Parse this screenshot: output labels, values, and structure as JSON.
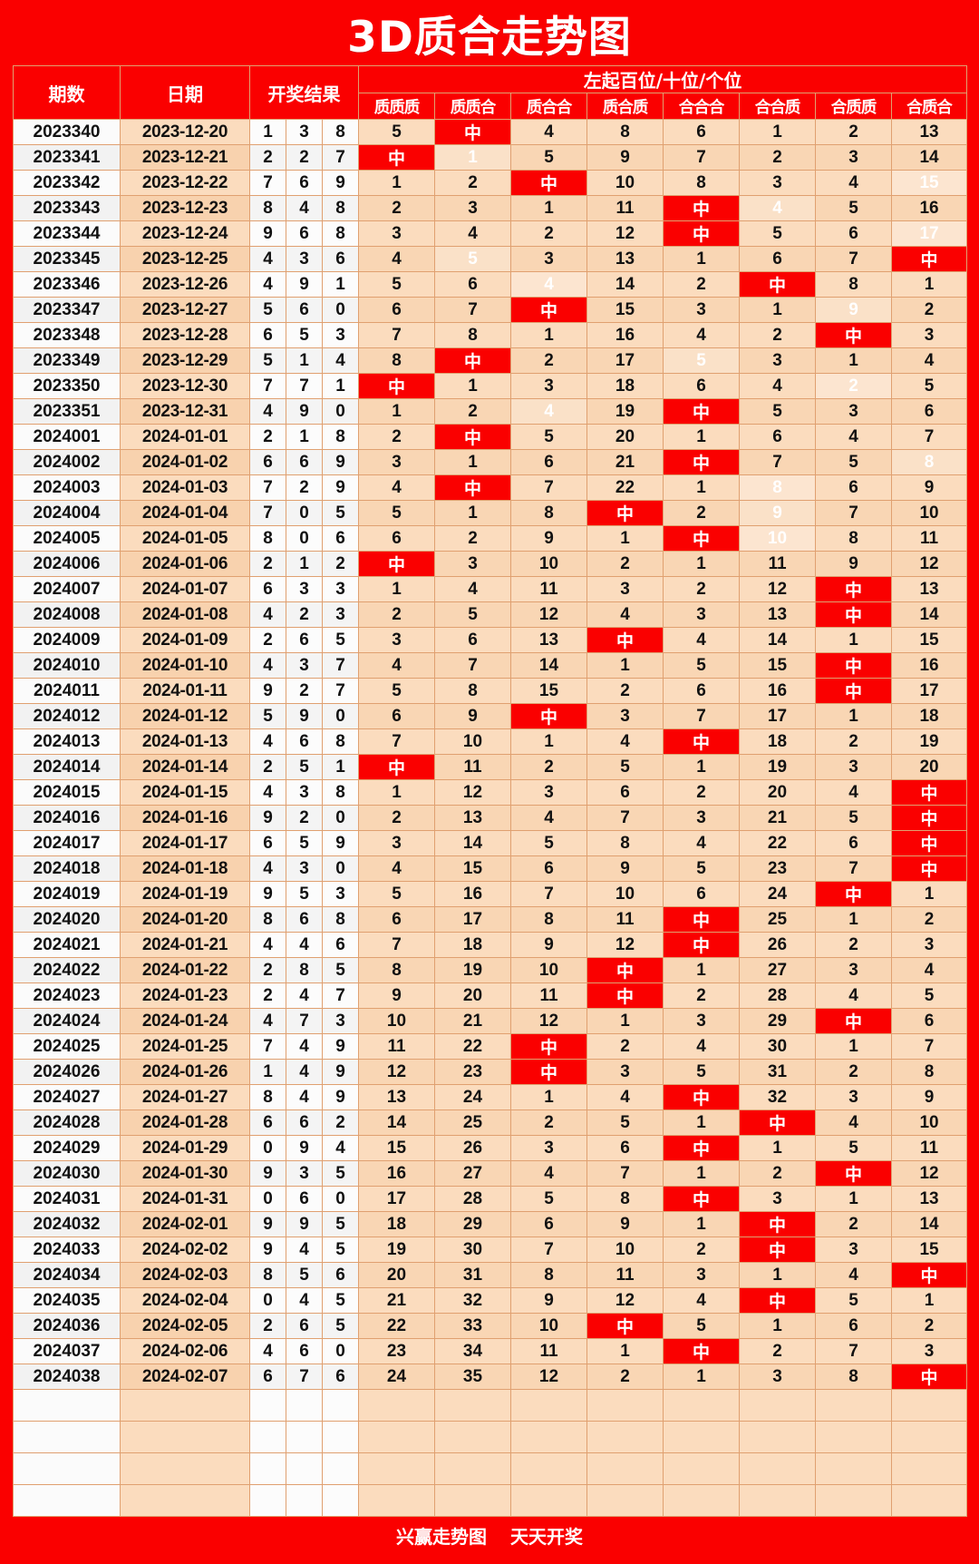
{
  "title": "3D质合走势图",
  "header": {
    "issue": "期数",
    "date": "日期",
    "result": "开奖结果",
    "group": "左起百位/十位/个位",
    "columns": [
      "质质质",
      "质质合",
      "质合合",
      "质合质",
      "合合合",
      "合合质",
      "合质质",
      "合质合"
    ]
  },
  "footer": {
    "left": "兴赢走势图",
    "right": "天天开奖"
  },
  "colors": {
    "brand_red": "#fa0000",
    "hit_red": "#fa0000",
    "cell_peach": "#fbdcbe",
    "cell_white": "#fcfcfc",
    "grid_line": "#e0a070",
    "hit_text": "#ffffff",
    "faded_text": "#ffffff"
  },
  "hit_label": "中",
  "blank_rows": 4,
  "rows": [
    {
      "issue": "2023340",
      "date": "2023-12-20",
      "balls": [
        "1",
        "3",
        "8"
      ],
      "cells": [
        "5",
        "中",
        "4",
        "8",
        "6",
        "1",
        "2",
        "13"
      ],
      "faded": []
    },
    {
      "issue": "2023341",
      "date": "2023-12-21",
      "balls": [
        "2",
        "2",
        "7"
      ],
      "cells": [
        "中",
        "1",
        "5",
        "9",
        "7",
        "2",
        "3",
        "14"
      ],
      "faded": [
        1
      ]
    },
    {
      "issue": "2023342",
      "date": "2023-12-22",
      "balls": [
        "7",
        "6",
        "9"
      ],
      "cells": [
        "1",
        "2",
        "中",
        "10",
        "8",
        "3",
        "4",
        "15"
      ],
      "faded": [
        7
      ]
    },
    {
      "issue": "2023343",
      "date": "2023-12-23",
      "balls": [
        "8",
        "4",
        "8"
      ],
      "cells": [
        "2",
        "3",
        "1",
        "11",
        "中",
        "4",
        "5",
        "16"
      ],
      "faded": [
        5
      ]
    },
    {
      "issue": "2023344",
      "date": "2023-12-24",
      "balls": [
        "9",
        "6",
        "8"
      ],
      "cells": [
        "3",
        "4",
        "2",
        "12",
        "中",
        "5",
        "6",
        "17"
      ],
      "faded": [
        7
      ]
    },
    {
      "issue": "2023345",
      "date": "2023-12-25",
      "balls": [
        "4",
        "3",
        "6"
      ],
      "cells": [
        "4",
        "5",
        "3",
        "13",
        "1",
        "6",
        "7",
        "中"
      ],
      "faded": [
        1
      ]
    },
    {
      "issue": "2023346",
      "date": "2023-12-26",
      "balls": [
        "4",
        "9",
        "1"
      ],
      "cells": [
        "5",
        "6",
        "4",
        "14",
        "2",
        "中",
        "8",
        "1"
      ],
      "faded": [
        2
      ]
    },
    {
      "issue": "2023347",
      "date": "2023-12-27",
      "balls": [
        "5",
        "6",
        "0"
      ],
      "cells": [
        "6",
        "7",
        "中",
        "15",
        "3",
        "1",
        "9",
        "2"
      ],
      "faded": [
        6
      ]
    },
    {
      "issue": "2023348",
      "date": "2023-12-28",
      "balls": [
        "6",
        "5",
        "3"
      ],
      "cells": [
        "7",
        "8",
        "1",
        "16",
        "4",
        "2",
        "中",
        "3"
      ],
      "faded": []
    },
    {
      "issue": "2023349",
      "date": "2023-12-29",
      "balls": [
        "5",
        "1",
        "4"
      ],
      "cells": [
        "8",
        "中",
        "2",
        "17",
        "5",
        "3",
        "1",
        "4"
      ],
      "faded": [
        4
      ]
    },
    {
      "issue": "2023350",
      "date": "2023-12-30",
      "balls": [
        "7",
        "7",
        "1"
      ],
      "cells": [
        "中",
        "1",
        "3",
        "18",
        "6",
        "4",
        "2",
        "5"
      ],
      "faded": [
        6
      ]
    },
    {
      "issue": "2023351",
      "date": "2023-12-31",
      "balls": [
        "4",
        "9",
        "0"
      ],
      "cells": [
        "1",
        "2",
        "4",
        "19",
        "中",
        "5",
        "3",
        "6"
      ],
      "faded": [
        2
      ]
    },
    {
      "issue": "2024001",
      "date": "2024-01-01",
      "balls": [
        "2",
        "1",
        "8"
      ],
      "cells": [
        "2",
        "中",
        "5",
        "20",
        "1",
        "6",
        "4",
        "7"
      ],
      "faded": []
    },
    {
      "issue": "2024002",
      "date": "2024-01-02",
      "balls": [
        "6",
        "6",
        "9"
      ],
      "cells": [
        "3",
        "1",
        "6",
        "21",
        "中",
        "7",
        "5",
        "8"
      ],
      "faded": [
        7
      ]
    },
    {
      "issue": "2024003",
      "date": "2024-01-03",
      "balls": [
        "7",
        "2",
        "9"
      ],
      "cells": [
        "4",
        "中",
        "7",
        "22",
        "1",
        "8",
        "6",
        "9"
      ],
      "faded": [
        5
      ]
    },
    {
      "issue": "2024004",
      "date": "2024-01-04",
      "balls": [
        "7",
        "0",
        "5"
      ],
      "cells": [
        "5",
        "1",
        "8",
        "中",
        "2",
        "9",
        "7",
        "10"
      ],
      "faded": [
        5
      ]
    },
    {
      "issue": "2024005",
      "date": "2024-01-05",
      "balls": [
        "8",
        "0",
        "6"
      ],
      "cells": [
        "6",
        "2",
        "9",
        "1",
        "中",
        "10",
        "8",
        "11"
      ],
      "faded": [
        5
      ]
    },
    {
      "issue": "2024006",
      "date": "2024-01-06",
      "balls": [
        "2",
        "1",
        "2"
      ],
      "cells": [
        "中",
        "3",
        "10",
        "2",
        "1",
        "11",
        "9",
        "12"
      ],
      "faded": []
    },
    {
      "issue": "2024007",
      "date": "2024-01-07",
      "balls": [
        "6",
        "3",
        "3"
      ],
      "cells": [
        "1",
        "4",
        "11",
        "3",
        "2",
        "12",
        "中",
        "13"
      ],
      "faded": []
    },
    {
      "issue": "2024008",
      "date": "2024-01-08",
      "balls": [
        "4",
        "2",
        "3"
      ],
      "cells": [
        "2",
        "5",
        "12",
        "4",
        "3",
        "13",
        "中",
        "14"
      ],
      "faded": []
    },
    {
      "issue": "2024009",
      "date": "2024-01-09",
      "balls": [
        "2",
        "6",
        "5"
      ],
      "cells": [
        "3",
        "6",
        "13",
        "中",
        "4",
        "14",
        "1",
        "15"
      ],
      "faded": []
    },
    {
      "issue": "2024010",
      "date": "2024-01-10",
      "balls": [
        "4",
        "3",
        "7"
      ],
      "cells": [
        "4",
        "7",
        "14",
        "1",
        "5",
        "15",
        "中",
        "16"
      ],
      "faded": []
    },
    {
      "issue": "2024011",
      "date": "2024-01-11",
      "balls": [
        "9",
        "2",
        "7"
      ],
      "cells": [
        "5",
        "8",
        "15",
        "2",
        "6",
        "16",
        "中",
        "17"
      ],
      "faded": []
    },
    {
      "issue": "2024012",
      "date": "2024-01-12",
      "balls": [
        "5",
        "9",
        "0"
      ],
      "cells": [
        "6",
        "9",
        "中",
        "3",
        "7",
        "17",
        "1",
        "18"
      ],
      "faded": []
    },
    {
      "issue": "2024013",
      "date": "2024-01-13",
      "balls": [
        "4",
        "6",
        "8"
      ],
      "cells": [
        "7",
        "10",
        "1",
        "4",
        "中",
        "18",
        "2",
        "19"
      ],
      "faded": []
    },
    {
      "issue": "2024014",
      "date": "2024-01-14",
      "balls": [
        "2",
        "5",
        "1"
      ],
      "cells": [
        "中",
        "11",
        "2",
        "5",
        "1",
        "19",
        "3",
        "20"
      ],
      "faded": []
    },
    {
      "issue": "2024015",
      "date": "2024-01-15",
      "balls": [
        "4",
        "3",
        "8"
      ],
      "cells": [
        "1",
        "12",
        "3",
        "6",
        "2",
        "20",
        "4",
        "中"
      ],
      "faded": []
    },
    {
      "issue": "2024016",
      "date": "2024-01-16",
      "balls": [
        "9",
        "2",
        "0"
      ],
      "cells": [
        "2",
        "13",
        "4",
        "7",
        "3",
        "21",
        "5",
        "中"
      ],
      "faded": []
    },
    {
      "issue": "2024017",
      "date": "2024-01-17",
      "balls": [
        "6",
        "5",
        "9"
      ],
      "cells": [
        "3",
        "14",
        "5",
        "8",
        "4",
        "22",
        "6",
        "中"
      ],
      "faded": []
    },
    {
      "issue": "2024018",
      "date": "2024-01-18",
      "balls": [
        "4",
        "3",
        "0"
      ],
      "cells": [
        "4",
        "15",
        "6",
        "9",
        "5",
        "23",
        "7",
        "中"
      ],
      "faded": []
    },
    {
      "issue": "2024019",
      "date": "2024-01-19",
      "balls": [
        "9",
        "5",
        "3"
      ],
      "cells": [
        "5",
        "16",
        "7",
        "10",
        "6",
        "24",
        "中",
        "1"
      ],
      "faded": []
    },
    {
      "issue": "2024020",
      "date": "2024-01-20",
      "balls": [
        "8",
        "6",
        "8"
      ],
      "cells": [
        "6",
        "17",
        "8",
        "11",
        "中",
        "25",
        "1",
        "2"
      ],
      "faded": []
    },
    {
      "issue": "2024021",
      "date": "2024-01-21",
      "balls": [
        "4",
        "4",
        "6"
      ],
      "cells": [
        "7",
        "18",
        "9",
        "12",
        "中",
        "26",
        "2",
        "3"
      ],
      "faded": []
    },
    {
      "issue": "2024022",
      "date": "2024-01-22",
      "balls": [
        "2",
        "8",
        "5"
      ],
      "cells": [
        "8",
        "19",
        "10",
        "中",
        "1",
        "27",
        "3",
        "4"
      ],
      "faded": []
    },
    {
      "issue": "2024023",
      "date": "2024-01-23",
      "balls": [
        "2",
        "4",
        "7"
      ],
      "cells": [
        "9",
        "20",
        "11",
        "中",
        "2",
        "28",
        "4",
        "5"
      ],
      "faded": []
    },
    {
      "issue": "2024024",
      "date": "2024-01-24",
      "balls": [
        "4",
        "7",
        "3"
      ],
      "cells": [
        "10",
        "21",
        "12",
        "1",
        "3",
        "29",
        "中",
        "6"
      ],
      "faded": []
    },
    {
      "issue": "2024025",
      "date": "2024-01-25",
      "balls": [
        "7",
        "4",
        "9"
      ],
      "cells": [
        "11",
        "22",
        "中",
        "2",
        "4",
        "30",
        "1",
        "7"
      ],
      "faded": []
    },
    {
      "issue": "2024026",
      "date": "2024-01-26",
      "balls": [
        "1",
        "4",
        "9"
      ],
      "cells": [
        "12",
        "23",
        "中",
        "3",
        "5",
        "31",
        "2",
        "8"
      ],
      "faded": []
    },
    {
      "issue": "2024027",
      "date": "2024-01-27",
      "balls": [
        "8",
        "4",
        "9"
      ],
      "cells": [
        "13",
        "24",
        "1",
        "4",
        "中",
        "32",
        "3",
        "9"
      ],
      "faded": []
    },
    {
      "issue": "2024028",
      "date": "2024-01-28",
      "balls": [
        "6",
        "6",
        "2"
      ],
      "cells": [
        "14",
        "25",
        "2",
        "5",
        "1",
        "中",
        "4",
        "10"
      ],
      "faded": []
    },
    {
      "issue": "2024029",
      "date": "2024-01-29",
      "balls": [
        "0",
        "9",
        "4"
      ],
      "cells": [
        "15",
        "26",
        "3",
        "6",
        "中",
        "1",
        "5",
        "11"
      ],
      "faded": []
    },
    {
      "issue": "2024030",
      "date": "2024-01-30",
      "balls": [
        "9",
        "3",
        "5"
      ],
      "cells": [
        "16",
        "27",
        "4",
        "7",
        "1",
        "2",
        "中",
        "12"
      ],
      "faded": []
    },
    {
      "issue": "2024031",
      "date": "2024-01-31",
      "balls": [
        "0",
        "6",
        "0"
      ],
      "cells": [
        "17",
        "28",
        "5",
        "8",
        "中",
        "3",
        "1",
        "13"
      ],
      "faded": []
    },
    {
      "issue": "2024032",
      "date": "2024-02-01",
      "balls": [
        "9",
        "9",
        "5"
      ],
      "cells": [
        "18",
        "29",
        "6",
        "9",
        "1",
        "中",
        "2",
        "14"
      ],
      "faded": []
    },
    {
      "issue": "2024033",
      "date": "2024-02-02",
      "balls": [
        "9",
        "4",
        "5"
      ],
      "cells": [
        "19",
        "30",
        "7",
        "10",
        "2",
        "中",
        "3",
        "15"
      ],
      "faded": []
    },
    {
      "issue": "2024034",
      "date": "2024-02-03",
      "balls": [
        "8",
        "5",
        "6"
      ],
      "cells": [
        "20",
        "31",
        "8",
        "11",
        "3",
        "1",
        "4",
        "中"
      ],
      "faded": []
    },
    {
      "issue": "2024035",
      "date": "2024-02-04",
      "balls": [
        "0",
        "4",
        "5"
      ],
      "cells": [
        "21",
        "32",
        "9",
        "12",
        "4",
        "中",
        "5",
        "1"
      ],
      "faded": []
    },
    {
      "issue": "2024036",
      "date": "2024-02-05",
      "balls": [
        "2",
        "6",
        "5"
      ],
      "cells": [
        "22",
        "33",
        "10",
        "中",
        "5",
        "1",
        "6",
        "2"
      ],
      "faded": []
    },
    {
      "issue": "2024037",
      "date": "2024-02-06",
      "balls": [
        "4",
        "6",
        "0"
      ],
      "cells": [
        "23",
        "34",
        "11",
        "1",
        "中",
        "2",
        "7",
        "3"
      ],
      "faded": []
    },
    {
      "issue": "2024038",
      "date": "2024-02-07",
      "balls": [
        "6",
        "7",
        "6"
      ],
      "cells": [
        "24",
        "35",
        "12",
        "2",
        "1",
        "3",
        "8",
        "中"
      ],
      "faded": []
    }
  ]
}
